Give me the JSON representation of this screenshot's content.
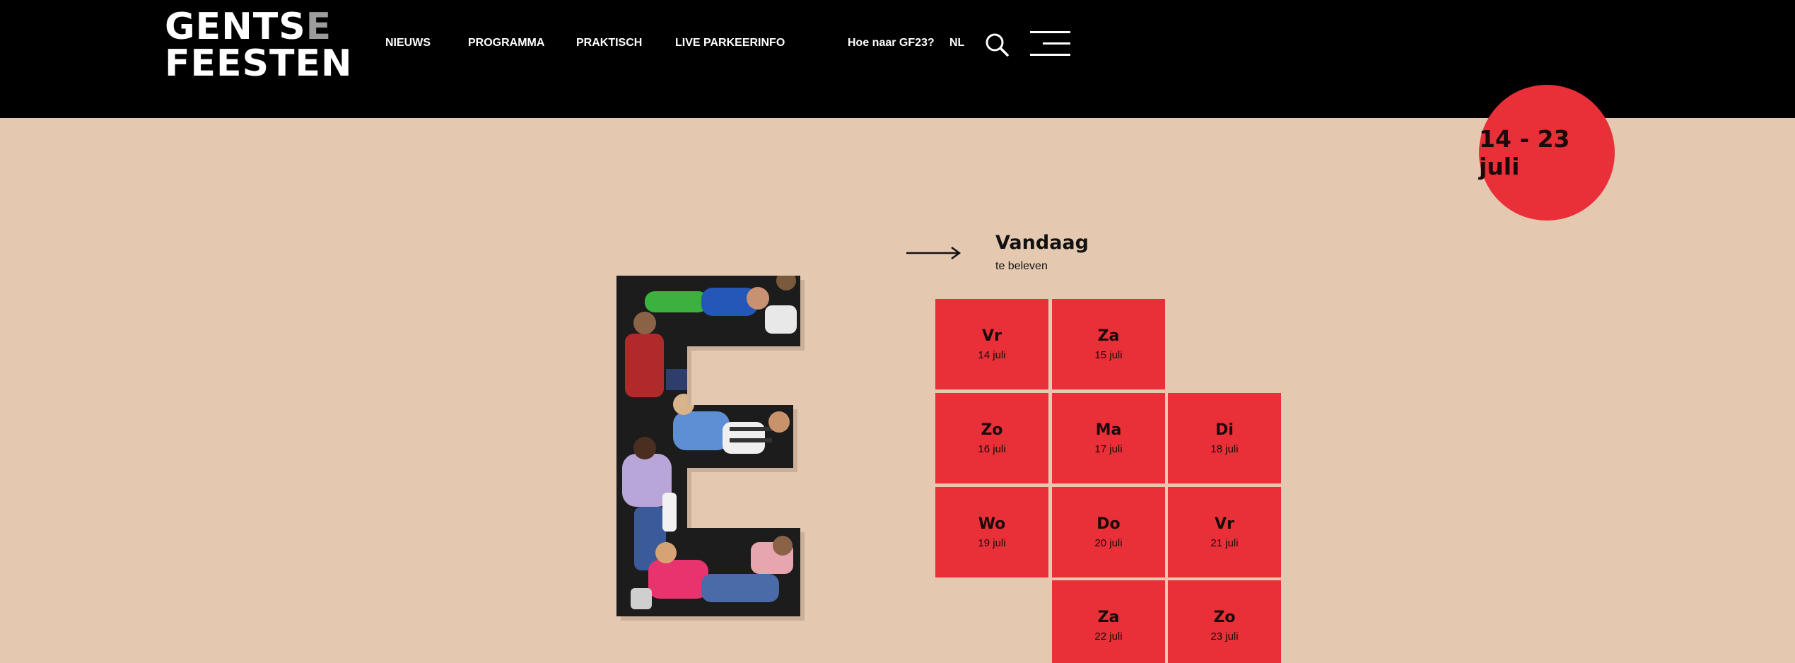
{
  "header": {
    "logo_line1_main": "GENTS",
    "logo_line1_accent": "E",
    "logo_line2": "FEESTEN",
    "nav": [
      {
        "label": "NIEUWS"
      },
      {
        "label": "PROGRAMMA"
      },
      {
        "label": "PRAKTISCH"
      },
      {
        "label": "LIVE PARKEERINFO"
      }
    ],
    "route_link": "Hoe naar GF23?",
    "language": "NL",
    "icons": [
      "search-icon",
      "hamburger-menu-icon"
    ]
  },
  "badge": {
    "dates": "14 - 23 juli"
  },
  "today": {
    "title": "Vandaag",
    "subtitle": "te beleven",
    "icon": "arrow-right-icon"
  },
  "days": [
    {
      "name": "Vr",
      "date": "14 juli"
    },
    {
      "name": "Za",
      "date": "15 juli"
    },
    {
      "name": "Zo",
      "date": "16 juli"
    },
    {
      "name": "Ma",
      "date": "17 juli"
    },
    {
      "name": "Di",
      "date": "18 juli"
    },
    {
      "name": "Wo",
      "date": "19 juli"
    },
    {
      "name": "Do",
      "date": "20 juli"
    },
    {
      "name": "Vr",
      "date": "21 juli"
    },
    {
      "name": "Za",
      "date": "22 juli"
    },
    {
      "name": "Zo",
      "date": "23 juli"
    }
  ],
  "colors": {
    "background": "#e4c8b0",
    "header": "#000000",
    "accent": "#e93039"
  }
}
